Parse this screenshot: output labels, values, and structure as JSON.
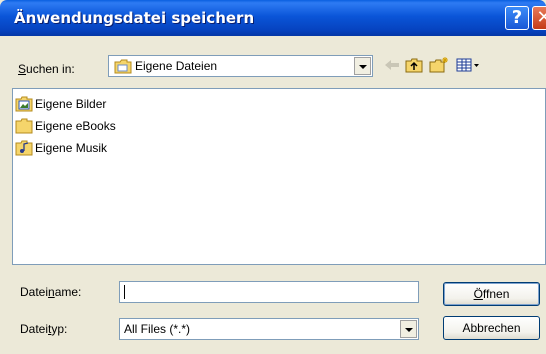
{
  "window": {
    "title": "Änwendungsdatei speichern",
    "help_glyph": "?",
    "close_glyph": "✕"
  },
  "lookin": {
    "label_accel": "S",
    "label_rest": "uchen in:",
    "value": "Eigene Dateien",
    "toolbar_icons": [
      "back-arrow-icon",
      "up-folder-icon",
      "new-folder-icon",
      "view-menu-icon"
    ]
  },
  "files": [
    {
      "name": "Eigene Bilder",
      "icon": "pictures-folder-icon"
    },
    {
      "name": "Eigene eBooks",
      "icon": "folder-icon"
    },
    {
      "name": "Eigene Musik",
      "icon": "music-folder-icon"
    }
  ],
  "filename": {
    "label_pre": "Datei",
    "label_accel": "n",
    "label_post": "ame:",
    "value": ""
  },
  "filetype": {
    "label_pre": "Datei",
    "label_accel": "t",
    "label_post": "yp:",
    "value": "All Files (*.*)"
  },
  "buttons": {
    "open_accel": "Ö",
    "open_rest": "ffnen",
    "cancel": "Abbrechen"
  },
  "colors": {
    "title_blue": "#0A55D8",
    "close_red": "#C43B17",
    "dialog_bg": "#ECE9D8"
  }
}
